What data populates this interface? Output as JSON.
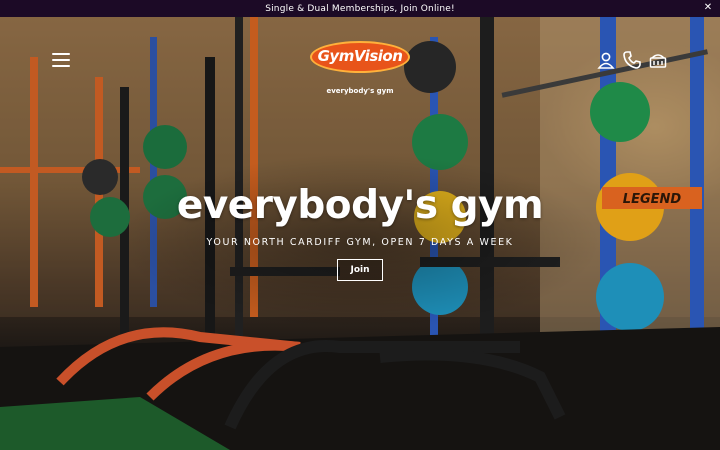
{
  "announcement": {
    "text": "Single & Dual Memberships, Join Online!",
    "close_icon": "close-icon"
  },
  "header": {
    "menu_icon": "hamburger-menu-icon",
    "logo": {
      "name": "GymVision",
      "tagline": "everybody's gym"
    },
    "icons": [
      "account-icon",
      "phone-icon",
      "cart-icon"
    ]
  },
  "hero": {
    "title": "everybody's gym",
    "subtitle": "YOUR NORTH CARDIFF GYM, OPEN 7 DAYS A WEEK",
    "button_label": "Join"
  },
  "colors": {
    "announcement_bg": "#1c0a26",
    "logo_orange": "#e8541a",
    "logo_yellow": "#ffb13b"
  }
}
